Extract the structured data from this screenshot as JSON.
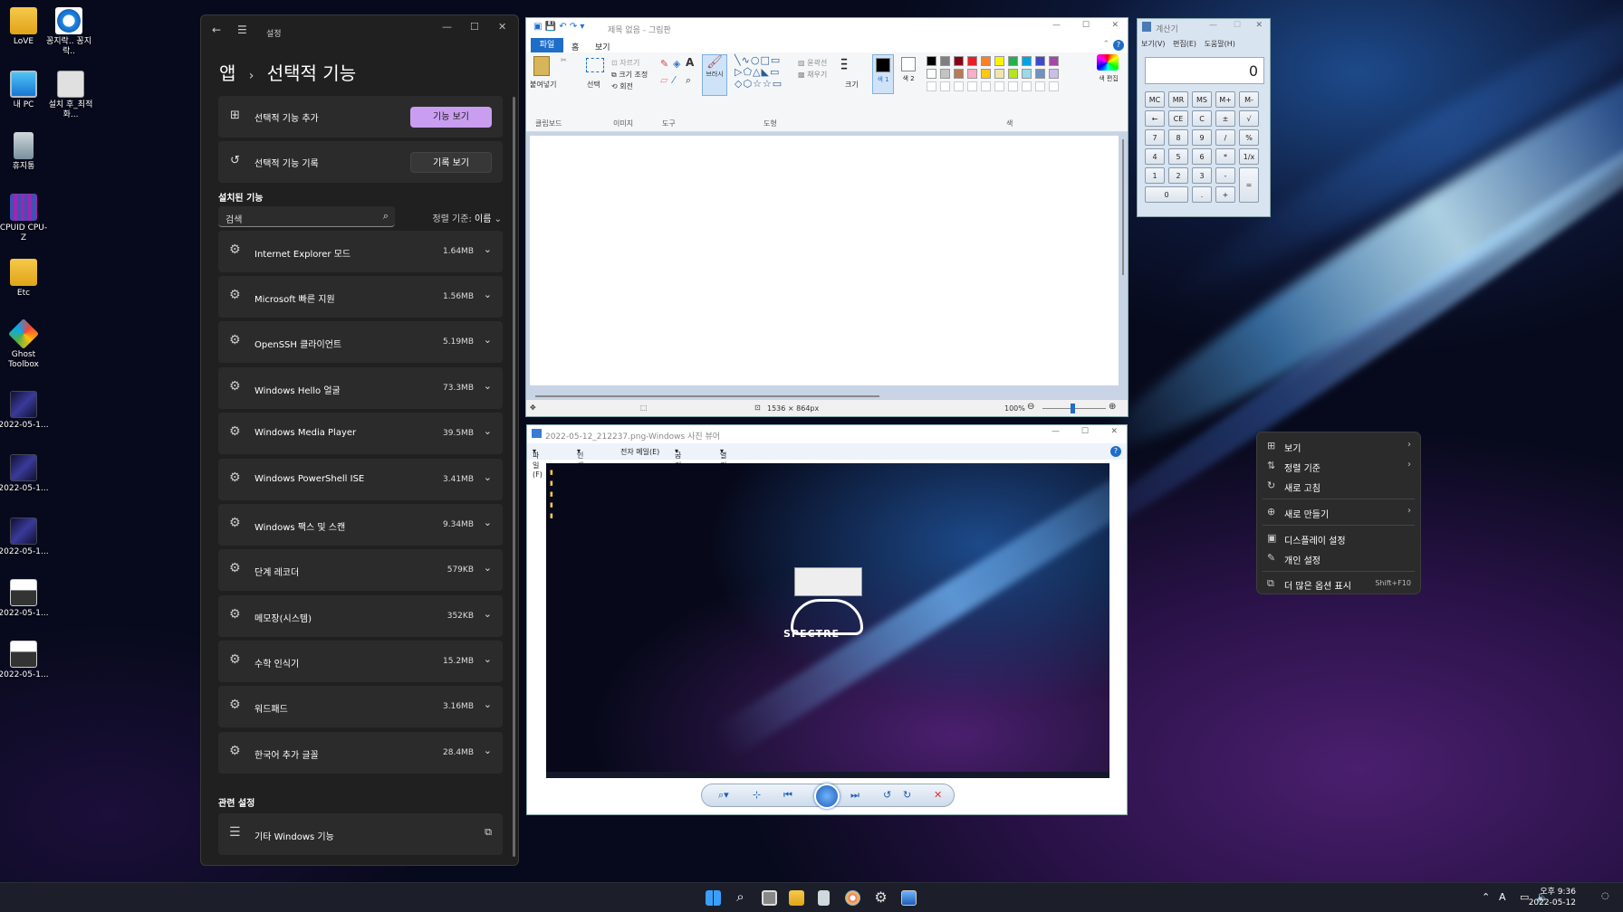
{
  "desktop": {
    "icons": [
      {
        "label": "LoVE",
        "icon": "folder-icon"
      },
      {
        "label": "꽁지락.. 꽁지락..",
        "icon": "ie-icon"
      },
      {
        "label": "내 PC",
        "icon": "computer-icon"
      },
      {
        "label": "설치 후_최적화...",
        "icon": "settings-doc-icon"
      },
      {
        "label": "휴지통",
        "icon": "recycle-bin-icon"
      },
      {
        "label": "CPUID CPU-Z",
        "icon": "cpuz-icon"
      },
      {
        "label": "Etc",
        "icon": "folder-icon"
      },
      {
        "label": "Ghost Toolbox",
        "icon": "ghost-toolbox-icon"
      },
      {
        "label": "2022-05-1...",
        "icon": "image-file-icon"
      },
      {
        "label": "2022-05-1...",
        "icon": "image-file-icon"
      },
      {
        "label": "2022-05-1...",
        "icon": "image-file-icon"
      },
      {
        "label": "2022-05-1...",
        "icon": "image-file-icon"
      },
      {
        "label": "2022-05-1...",
        "icon": "image-file-icon"
      }
    ]
  },
  "settings": {
    "window_title": "설정",
    "breadcrumb_parent": "앱",
    "breadcrumb_sep": "›",
    "page_title": "선택적 기능",
    "add_feature": {
      "label": "선택적 기능 추가",
      "button": "기능 보기"
    },
    "feature_history": {
      "label": "선택적 기능 기록",
      "button": "기록 보기"
    },
    "installed_title": "설치된 기능",
    "search_placeholder": "검색",
    "sort_label": "정렬 기준:",
    "sort_value": "이름",
    "features": [
      {
        "name": "Internet Explorer 모드",
        "size": "1.64MB"
      },
      {
        "name": "Microsoft 빠른 지원",
        "size": "1.56MB"
      },
      {
        "name": "OpenSSH 클라이언트",
        "size": "5.19MB"
      },
      {
        "name": "Windows Hello 얼굴",
        "size": "73.3MB"
      },
      {
        "name": "Windows Media Player",
        "size": "39.5MB"
      },
      {
        "name": "Windows PowerShell ISE",
        "size": "3.41MB"
      },
      {
        "name": "Windows 팩스 및 스캔",
        "size": "9.34MB"
      },
      {
        "name": "단계 레코더",
        "size": "579KB"
      },
      {
        "name": "메모장(시스템)",
        "size": "352KB"
      },
      {
        "name": "수학 인식기",
        "size": "15.2MB"
      },
      {
        "name": "워드패드",
        "size": "3.16MB"
      },
      {
        "name": "한국어 추가 글꼴",
        "size": "28.4MB"
      }
    ],
    "related_title": "관련 설정",
    "related_item": "기타 Windows 기능",
    "accent_color": "#c99ef0"
  },
  "paint": {
    "window_title": "제목 없음 - 그림판",
    "tabs": [
      "파일",
      "홈",
      "보기"
    ],
    "clipboard": {
      "paste": "붙여넣기",
      "group": "클립보드"
    },
    "image": {
      "select": "선택",
      "crop": "자르기",
      "resize": "크기 조정",
      "rotate": "회전",
      "group": "이미지"
    },
    "tools_group": "도구",
    "brush": "브러시",
    "shapes": {
      "outline": "윤곽선",
      "fill": "채우기",
      "group": "도형"
    },
    "size": "크기",
    "color1": "색 1",
    "color2": "색 2",
    "colors_group": "색",
    "edit_colors": "색 편집",
    "status_size": "1536 × 864px",
    "zoom": "100%",
    "palette": [
      "#000000",
      "#7f7f7f",
      "#880015",
      "#ed1c24",
      "#ff7f27",
      "#fff200",
      "#22b14c",
      "#00a2e8",
      "#3f48cc",
      "#a349a4",
      "#ffffff",
      "#c3c3c3",
      "#b97a57",
      "#ffaec9",
      "#ffc90e",
      "#efe4b0",
      "#b5e61d",
      "#99d9ea",
      "#7092be",
      "#c8bfe7"
    ]
  },
  "calculator": {
    "window_title": "계산기",
    "menu": [
      "보기(V)",
      "편집(E)",
      "도움말(H)"
    ],
    "display": "0",
    "keys": [
      [
        "MC",
        "MR",
        "MS",
        "M+",
        "M-"
      ],
      [
        "←",
        "CE",
        "C",
        "±",
        "√"
      ],
      [
        "7",
        "8",
        "9",
        "/",
        "%"
      ],
      [
        "4",
        "5",
        "6",
        "*",
        "1/x"
      ],
      [
        "1",
        "2",
        "3",
        "-",
        "="
      ],
      [
        "0",
        ".",
        "+"
      ]
    ]
  },
  "viewer": {
    "window_title": "2022-05-12_212237.png-Windows 사진 뷰어",
    "menu": [
      "파일(F)",
      "인쇄(P)",
      "전자 메일(E)",
      "굽기(U)",
      "열기(O)"
    ],
    "logo_text": "SPECTRE"
  },
  "context_menu": {
    "items": [
      {
        "label": "보기",
        "icon": "view-grid-icon",
        "arrow": "›"
      },
      {
        "label": "정렬 기준",
        "icon": "sort-icon",
        "arrow": "›"
      },
      {
        "label": "새로 고침",
        "icon": "refresh-icon"
      },
      {
        "label": "새로 만들기",
        "icon": "new-plus-icon",
        "arrow": "›"
      },
      {
        "label": "디스플레이 설정",
        "icon": "display-icon"
      },
      {
        "label": "개인 설정",
        "icon": "brush-icon"
      },
      {
        "label": "더 많은 옵션 표시",
        "icon": "more-options-icon",
        "shortcut": "Shift+F10"
      }
    ]
  },
  "taskbar": {
    "time": "오후 9:36",
    "date": "2022-05-12",
    "ime": "A"
  }
}
